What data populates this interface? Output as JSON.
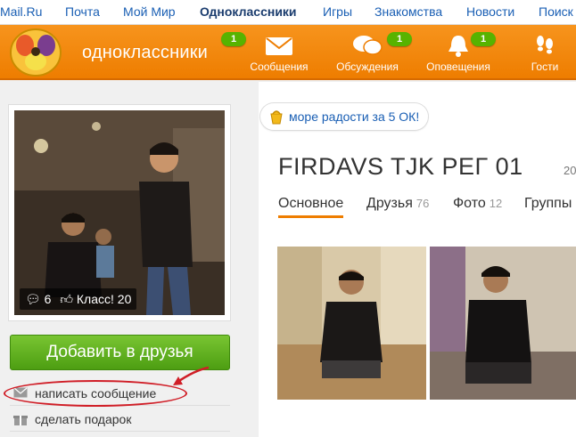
{
  "portal": {
    "links": [
      "Mail.Ru",
      "Почта",
      "Мой Мир",
      "Одноклассники",
      "Игры",
      "Знакомства",
      "Новости",
      "Поиск"
    ],
    "active_index": 3
  },
  "header": {
    "brand": "одноклассники",
    "nav": [
      {
        "label": "Сообщения",
        "badge": "1",
        "icon": "envelope-icon"
      },
      {
        "label": "Обсуждения",
        "badge": "1",
        "icon": "chat-bubbles-icon"
      },
      {
        "label": "Оповещения",
        "badge": "1",
        "icon": "bell-icon"
      },
      {
        "label": "Гости",
        "badge": "",
        "icon": "footprints-icon"
      }
    ],
    "brand_badge": "1",
    "colors": {
      "accent": "#ee7d00",
      "badge": "#57b300"
    }
  },
  "profile": {
    "comments": "6",
    "class_label": "Класс! 20",
    "add_friend": "Добавить в друзья",
    "actions": [
      "написать сообщение",
      "сделать подарок"
    ]
  },
  "main": {
    "promo": "море радости за 5 ОК!",
    "name": "FIRDAVS TJK РЕГ 01",
    "age": "20",
    "tabs": [
      {
        "label": "Основное",
        "count": ""
      },
      {
        "label": "Друзья",
        "count": "76"
      },
      {
        "label": "Фото",
        "count": "12"
      },
      {
        "label": "Группы",
        "count": ""
      }
    ]
  }
}
